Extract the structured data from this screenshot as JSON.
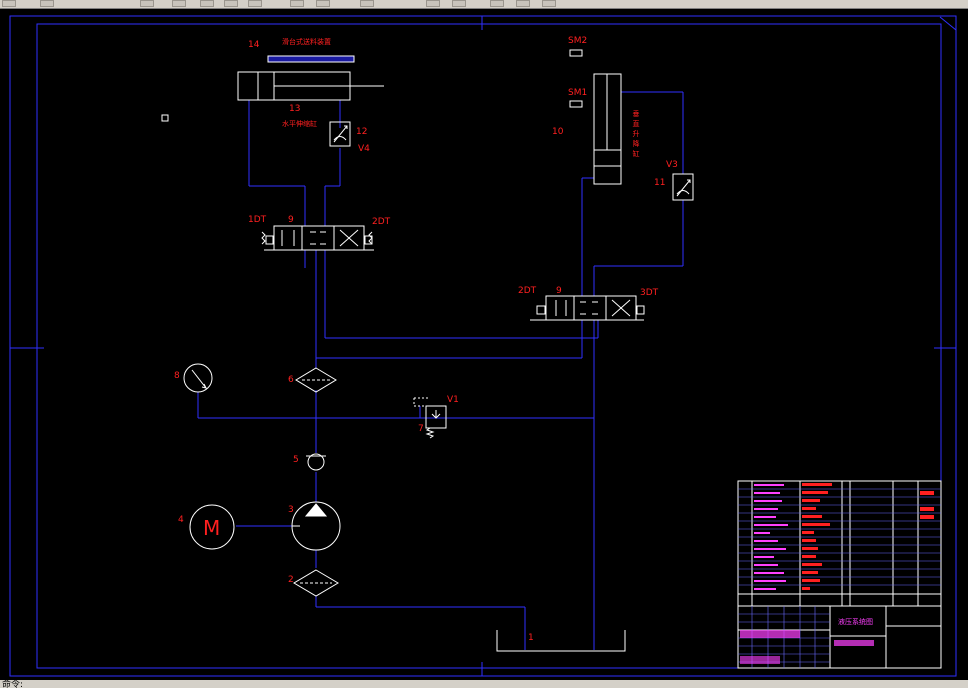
{
  "app": {
    "status_text": "命令:"
  },
  "colors": {
    "background": "#000000",
    "wire": "#3030ff",
    "symbol": "#ffffff",
    "label": "#ff2020",
    "table_text": "#ff40ff"
  },
  "drawing": {
    "components": {
      "c1": "1",
      "c2": "2",
      "c3": "3",
      "c4": "4",
      "c5": "5",
      "c6": "6",
      "c7": "7",
      "c8": "8",
      "c9a": "9",
      "c9b": "9",
      "c10": "10",
      "c11": "11",
      "c12": "12",
      "c13": "13",
      "c14": "14",
      "motor": "M"
    },
    "solenoids": {
      "s1dt": "1DT",
      "s2dt_top": "2DT",
      "s2dt_low": "2DT",
      "s3dt": "3DT"
    },
    "valves": {
      "v1": "V1",
      "v3": "V3",
      "v4": "V4"
    },
    "switches": {
      "sm1": "SM1",
      "sm2": "SM2"
    },
    "annotations": {
      "title_14": "滑台式送料装置",
      "label_13": "水平伸缩缸",
      "label_10": "垂直升降缸"
    },
    "title_block": {
      "drawing_name": "液压系统图"
    }
  }
}
